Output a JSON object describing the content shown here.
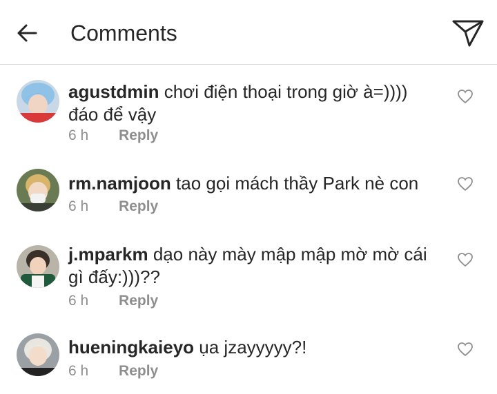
{
  "header": {
    "title": "Comments"
  },
  "comments": [
    {
      "username": "agustdmin",
      "text": "chơi điện thoại trong giờ à=)))) đáo để vậy",
      "time": "6 h",
      "reply": "Reply"
    },
    {
      "username": "rm.namjoon",
      "text": "tao gọi mách thầy Park nè con",
      "time": "6 h",
      "reply": "Reply"
    },
    {
      "username": "j.mparkm",
      "text": "dạo này mày mập mập mờ mờ cái gì đấy:)))??",
      "time": "6 h",
      "reply": "Reply"
    },
    {
      "username": "hueningkaieyo",
      "text": "ụa jzayyyyy?!",
      "time": "6 h",
      "reply": "Reply"
    }
  ]
}
